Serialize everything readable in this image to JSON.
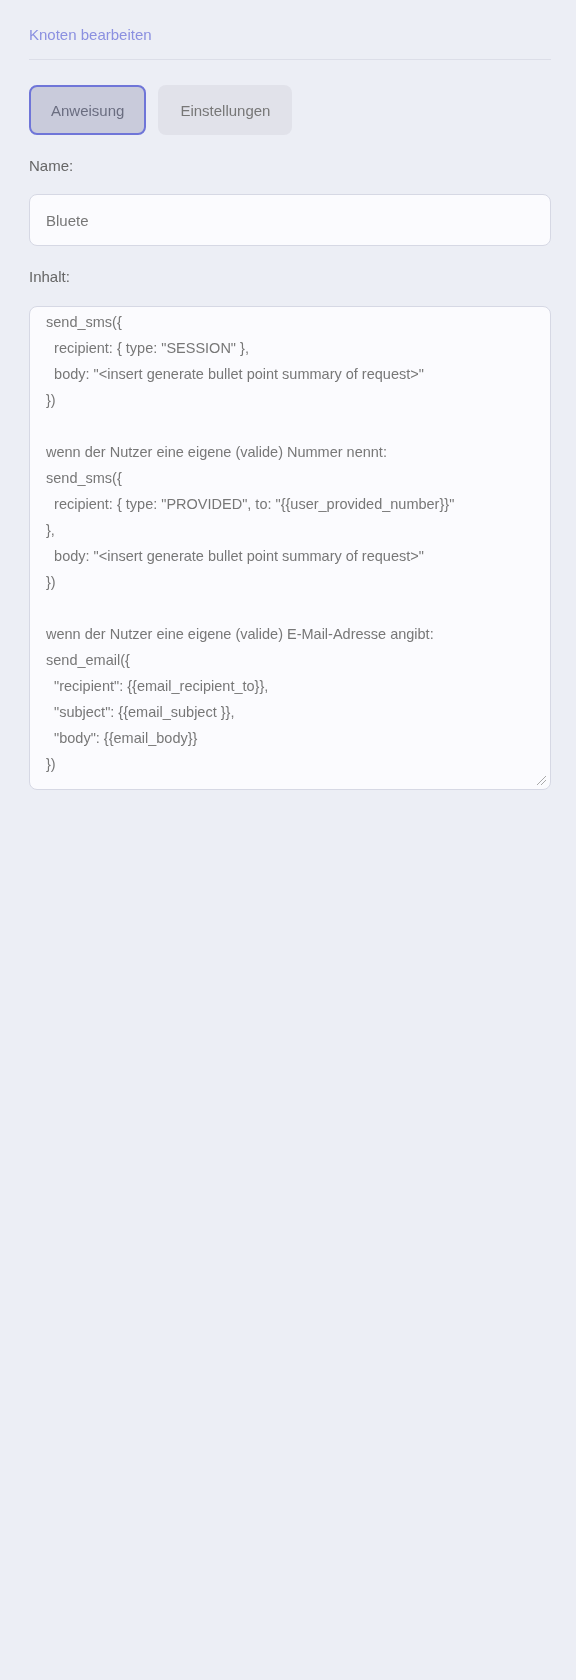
{
  "header": {
    "title": "Knoten bearbeiten"
  },
  "tabs": [
    {
      "label": "Anweisung",
      "selected": true
    },
    {
      "label": "Einstellungen",
      "selected": false
    }
  ],
  "name_field": {
    "label": "Name:",
    "value": "Bluete"
  },
  "content_field": {
    "label": "Inhalt:",
    "value": "send_sms({\n  recipient: { type: \"SESSION\" },\n  body: \"<insert generate bullet point summary of request>\"\n})\n\nwenn der Nutzer eine eigene (valide) Nummer nennt:\nsend_sms({\n  recipient: { type: \"PROVIDED\", to: \"{{user_provided_number}}\"\n},\n  body: \"<insert generate bullet point summary of request>\"\n})\n\nwenn der Nutzer eine eigene (valide) E-Mail-Adresse angibt:\nsend_email({\n  \"recipient\": {{email_recipient_to}},\n  \"subject\": {{email_subject }},\n  \"body\": {{email_body}}\n})"
  }
}
